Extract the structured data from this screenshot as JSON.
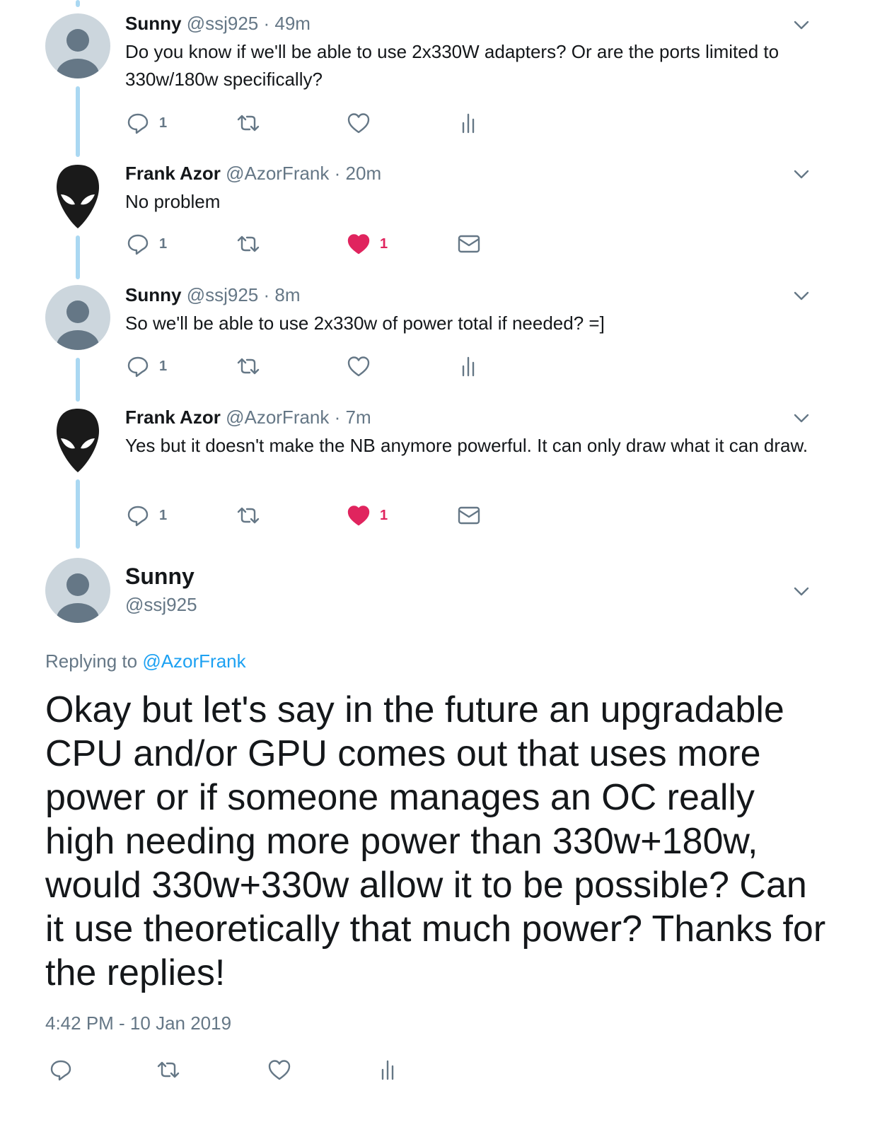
{
  "thread": [
    {
      "name": "Sunny",
      "handle": "@ssj925",
      "separator": "·",
      "time": "49m",
      "text": "Do you know if we'll be able to use 2x330W adapters? Or are the ports limited to 330w/180w specifically?",
      "reply_count": "1",
      "like_count": "",
      "liked": false,
      "fourth_action": "analytics-icon",
      "avatar": "default-profile-avatar"
    },
    {
      "name": "Frank Azor",
      "handle": "@AzorFrank",
      "separator": "·",
      "time": "20m",
      "text": "No problem",
      "reply_count": "1",
      "like_count": "1",
      "liked": true,
      "fourth_action": "direct-message-icon",
      "avatar": "alien-head-avatar"
    },
    {
      "name": "Sunny",
      "handle": "@ssj925",
      "separator": "·",
      "time": "8m",
      "text": "So we'll be able to use 2x330w of power total if needed? =]",
      "reply_count": "1",
      "like_count": "",
      "liked": false,
      "fourth_action": "analytics-icon",
      "avatar": "default-profile-avatar"
    },
    {
      "name": "Frank Azor",
      "handle": "@AzorFrank",
      "separator": "·",
      "time": "7m",
      "text": "Yes but it doesn't make the NB anymore powerful. It can only draw what it can draw.",
      "reply_count": "1",
      "like_count": "1",
      "liked": true,
      "fourth_action": "direct-message-icon",
      "avatar": "alien-head-avatar"
    }
  ],
  "main": {
    "name": "Sunny",
    "handle": "@ssj925",
    "replying_prefix": "Replying to",
    "replying_handle": "@AzorFrank",
    "text": "Okay but let's say in the future an upgradable CPU and/or GPU comes out that uses more power or if someone manages an OC really high needing more power than 330w+180w, would 330w+330w allow it to be possible? Can it use theoretically that much power? Thanks for the replies!",
    "timestamp": "4:42 PM - 10 Jan 2019"
  },
  "colors": {
    "text": "#14171a",
    "secondary": "#657786",
    "link": "#1da1f2",
    "like": "#e0245e",
    "thread_line": "#aad8f2",
    "avatar_bg": "#ccd6dd"
  }
}
